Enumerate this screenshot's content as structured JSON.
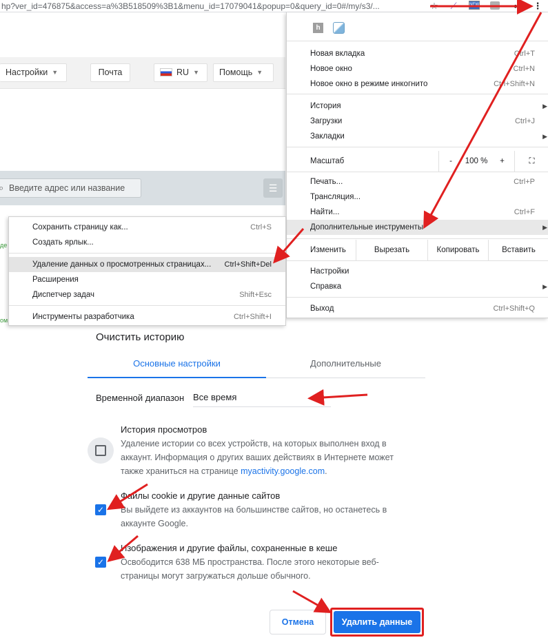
{
  "browser": {
    "url": "hp?ver_id=476875&access=a%3B518509%3B1&menu_id=17079041&popup=0&query_id=0#/my/s3/...",
    "toolbar_icons": [
      "star-icon",
      "extension-icon",
      "new-badge-icon",
      "extension-icon-2",
      "glasses-icon",
      "kebab-menu-icon"
    ],
    "new_badge": "NEW"
  },
  "site": {
    "nav": [
      {
        "label": "Настройки",
        "has_caret": true
      },
      {
        "label": "Почта",
        "has_caret": false
      },
      {
        "label": "RU",
        "has_caret": true,
        "flag": "ru"
      },
      {
        "label": "Помощь",
        "has_caret": true
      }
    ],
    "search_placeholder": "Введите адрес или название",
    "fragment_1": "де",
    "fragment_2": "ом"
  },
  "chrome_menu": {
    "top_icons": [
      "h-extension-icon",
      "bookmark-extension-icon"
    ],
    "new_tab": {
      "label": "Новая вкладка",
      "shortcut": "Ctrl+T"
    },
    "new_window": {
      "label": "Новое окно",
      "shortcut": "Ctrl+N"
    },
    "incognito": {
      "label": "Новое окно в режиме инкогнито",
      "shortcut": "Ctrl+Shift+N"
    },
    "history": {
      "label": "История"
    },
    "downloads": {
      "label": "Загрузки",
      "shortcut": "Ctrl+J"
    },
    "bookmarks": {
      "label": "Закладки"
    },
    "zoom": {
      "label": "Масштаб",
      "minus": "-",
      "value": "100 %",
      "plus": "+"
    },
    "print": {
      "label": "Печать...",
      "shortcut": "Ctrl+P"
    },
    "cast": {
      "label": "Трансляция..."
    },
    "find": {
      "label": "Найти...",
      "shortcut": "Ctrl+F"
    },
    "more_tools": {
      "label": "Дополнительные инструменты"
    },
    "edit": {
      "label": "Изменить",
      "cut": "Вырезать",
      "copy": "Копировать",
      "paste": "Вставить"
    },
    "settings": {
      "label": "Настройки"
    },
    "help": {
      "label": "Справка"
    },
    "exit": {
      "label": "Выход",
      "shortcut": "Ctrl+Shift+Q"
    }
  },
  "tools_menu": {
    "save_page": {
      "label": "Сохранить страницу как...",
      "shortcut": "Ctrl+S"
    },
    "create_shortcut": {
      "label": "Создать ярлык..."
    },
    "clear_data": {
      "label": "Удаление данных о просмотренных страницах...",
      "shortcut": "Ctrl+Shift+Del"
    },
    "extensions": {
      "label": "Расширения"
    },
    "task_manager": {
      "label": "Диспетчер задач",
      "shortcut": "Shift+Esc"
    },
    "dev_tools": {
      "label": "Инструменты разработчика",
      "shortcut": "Ctrl+Shift+I"
    }
  },
  "clear_history": {
    "title": "Очистить историю",
    "tab_basic": "Основные настройки",
    "tab_advanced": "Дополнительные",
    "time_range_label": "Временной диапазон",
    "time_range_value": "Все время",
    "options": [
      {
        "title": "История просмотров",
        "desc_1": "Удаление истории со всех устройств, на которых выполнен вход в",
        "desc_2": "аккаунт. Информация о других ваших действиях в Интернете может",
        "desc_3_pre": "также храниться на странице ",
        "desc_3_link": "myactivity.google.com",
        "desc_3_post": ".",
        "checked": false
      },
      {
        "title": "Файлы cookie и другие данные сайтов",
        "desc_1": "Вы выйдете из аккаунтов на большинстве сайтов, но останетесь в",
        "desc_2": "аккаунте Google.",
        "checked": true
      },
      {
        "title": "Изображения и другие файлы, сохраненные в кеше",
        "desc_1": "Освободится 638 МБ пространства. После этого некоторые веб-",
        "desc_2": "страницы могут загружаться дольше обычного.",
        "checked": true
      }
    ],
    "cancel": "Отмена",
    "delete": "Удалить данные"
  },
  "colors": {
    "accent": "#1a73e8",
    "annotation_red": "#e02020",
    "menu_highlight": "#e8e8e8"
  }
}
